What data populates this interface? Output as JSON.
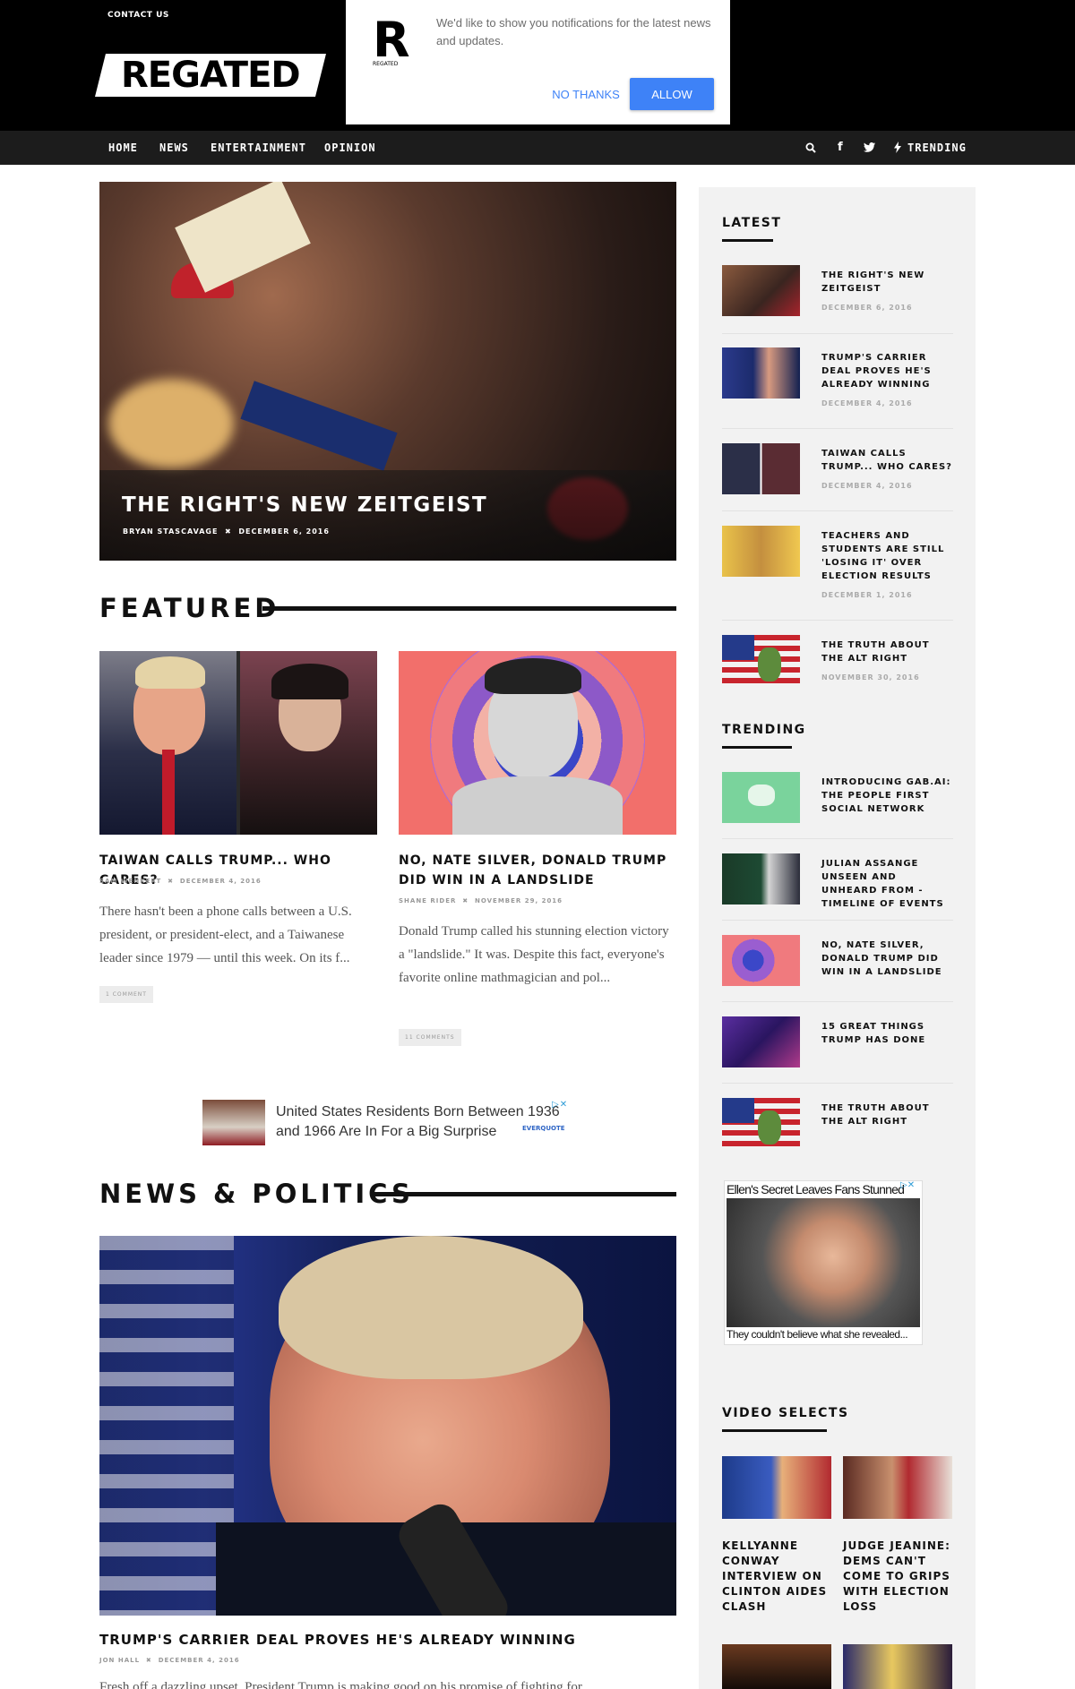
{
  "header": {
    "contact_label": "CONTACT US",
    "logo_text": "REGATED",
    "nav": [
      "HOME",
      "NEWS",
      "ENTERTAINMENT",
      "OPINION"
    ],
    "trending_label": "TRENDING",
    "icons": [
      "search-icon",
      "facebook-icon",
      "twitter-icon",
      "bolt-icon"
    ]
  },
  "notification": {
    "logo_letter": "R",
    "logo_sub": "REGATED",
    "message": "We'd like to show you notifications for the latest news and updates.",
    "deny_label": "NO THANKS",
    "allow_label": "ALLOW",
    "accent": "#3e82f7"
  },
  "hero": {
    "title": "THE RIGHT'S NEW ZEITGEIST",
    "author": "BRYAN STASCAVAGE",
    "date": "DECEMBER 6, 2016"
  },
  "featured": {
    "heading": "FEATURED",
    "articles": [
      {
        "title": "TAIWAN CALLS TRUMP... WHO CARES?",
        "author": "SAM WENKERT",
        "date": "DECEMBER 4, 2016",
        "excerpt": "There hasn't been a phone calls between a U.S. president, or president-elect, and a Taiwanese leader since 1979 — until this week. On its f...",
        "comments": "1 COMMENT"
      },
      {
        "title": "NO, NATE SILVER, DONALD TRUMP DID WIN IN A LANDSLIDE",
        "author": "SHANE RIDER",
        "date": "NOVEMBER 29, 2016",
        "excerpt": "Donald Trump called his stunning election victory a \"landslide.\" It was. Despite this fact, everyone's favorite online mathmagician and pol...",
        "comments": "11 COMMENTS"
      }
    ]
  },
  "ad": {
    "text": "United States Residents Born Between 1936 and 1966 Are In For a Big Surprise",
    "brand": "EVERQUOTE"
  },
  "news": {
    "heading": "NEWS & POLITICS",
    "title": "TRUMP'S CARRIER DEAL PROVES HE'S ALREADY WINNING",
    "author": "JON HALL",
    "date": "DECEMBER 4, 2016",
    "excerpt": "Fresh off a dazzling upset, President Trump is making good on his promise of fighting for..."
  },
  "sidebar": {
    "latest_heading": "LATEST",
    "latest": [
      {
        "title": "THE RIGHT'S NEW ZEITGEIST",
        "date": "DECEMBER 6, 2016"
      },
      {
        "title": "TRUMP'S CARRIER DEAL PROVES HE'S ALREADY WINNING",
        "date": "DECEMBER 4, 2016"
      },
      {
        "title": "TAIWAN CALLS TRUMP... WHO CARES?",
        "date": "DECEMBER 4, 2016"
      },
      {
        "title": "TEACHERS AND STUDENTS ARE STILL 'LOSING IT' OVER ELECTION RESULTS",
        "date": "DECEMBER 1, 2016"
      },
      {
        "title": "THE TRUTH ABOUT THE ALT RIGHT",
        "date": "NOVEMBER 30, 2016"
      }
    ],
    "trending_heading": "TRENDING",
    "trending": [
      {
        "title": "INTRODUCING GAB.AI: THE PEOPLE FIRST SOCIAL NETWORK"
      },
      {
        "title": "JULIAN ASSANGE UNSEEN AND UNHEARD FROM - TIMELINE OF EVENTS"
      },
      {
        "title": "NO, NATE SILVER, DONALD TRUMP DID WIN IN A LANDSLIDE"
      },
      {
        "title": "15 GREAT THINGS TRUMP HAS DONE"
      },
      {
        "title": "THE TRUTH ABOUT THE ALT RIGHT"
      }
    ],
    "ad_headline": "Ellen's Secret Leaves Fans Stunned",
    "ad_caption": "They couldn't believe what she revealed...",
    "video_heading": "VIDEO SELECTS",
    "videos": [
      {
        "title": "KELLYANNE CONWAY INTERVIEW ON CLINTON AIDES CLASH"
      },
      {
        "title": "JUDGE JEANINE: DEMS CAN'T COME TO GRIPS WITH ELECTION LOSS"
      }
    ]
  }
}
